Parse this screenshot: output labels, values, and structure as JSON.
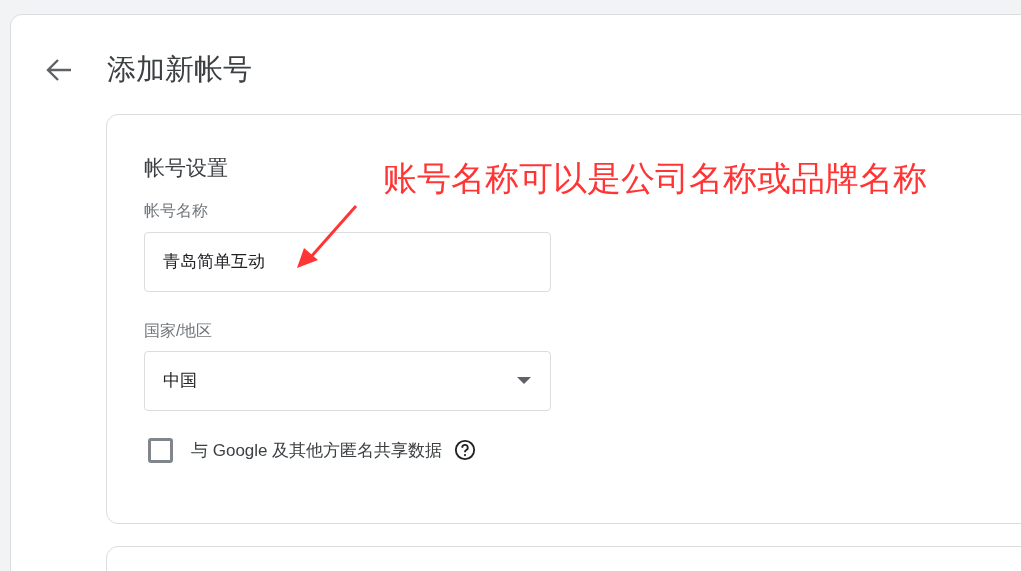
{
  "page": {
    "title": "添加新帐号"
  },
  "account_settings": {
    "title": "帐号设置",
    "account_name": {
      "label": "帐号名称",
      "value": "青岛简单互动"
    },
    "country": {
      "label": "国家/地区",
      "value": "中国"
    },
    "share_data": {
      "label": "与 Google 及其他方匿名共享数据",
      "checked": false
    }
  },
  "annotation": {
    "text": "账号名称可以是公司名称或品牌名称"
  }
}
